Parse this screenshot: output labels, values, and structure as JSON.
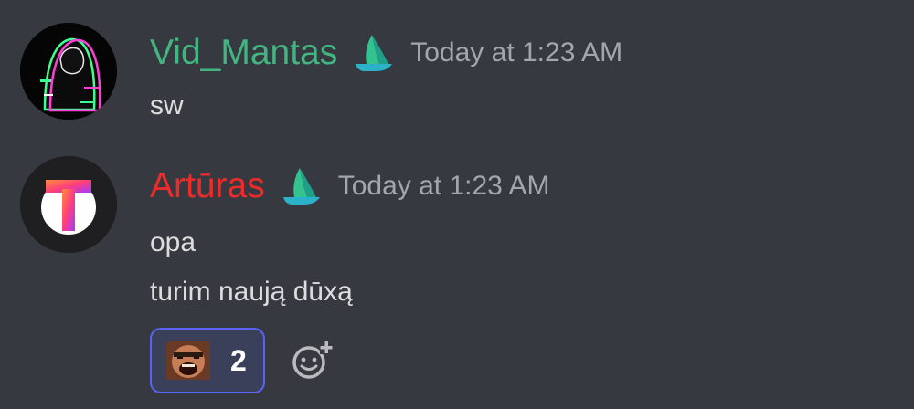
{
  "messages": [
    {
      "username": "Vid_Mantas",
      "username_color": "#43b581",
      "timestamp": "Today at 1:23 AM",
      "lines": [
        "sw"
      ],
      "avatar_icon": "hooded-figure-avatar",
      "role_icon": "sailboat-icon"
    },
    {
      "username": "Artūras",
      "username_color": "#ed2b2b",
      "timestamp": "Today at 1:23 AM",
      "lines": [
        "opa",
        "turim naują dūxą"
      ],
      "avatar_icon": "letter-t-avatar",
      "role_icon": "sailboat-icon",
      "reactions": [
        {
          "emoji_icon": "laughing-face-emoji",
          "count": "2",
          "active": true
        }
      ],
      "add_reaction_icon": "add-reaction-icon"
    }
  ],
  "colors": {
    "background": "#36393f",
    "message_text": "#dcddde",
    "timestamp": "#a3a6aa",
    "reaction_border": "#5865f2",
    "reaction_background": "#3b405a"
  }
}
